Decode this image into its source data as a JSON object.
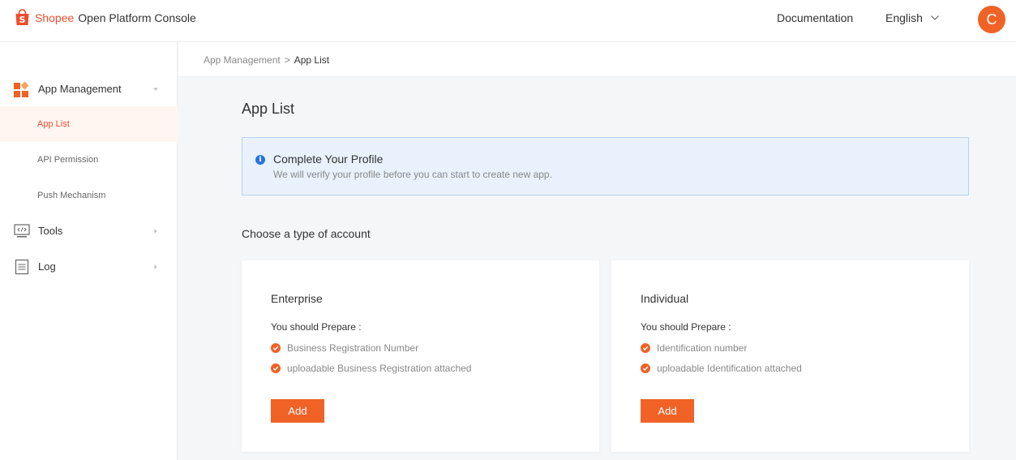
{
  "header": {
    "brand": "Shopee",
    "product": "Open Platform Console",
    "documentation": "Documentation",
    "language": "English",
    "avatar_initial": "C",
    "accent_color": "#ee4d2d"
  },
  "sidebar": {
    "groups": [
      {
        "label": "App Management",
        "icon": "app-grid-icon"
      },
      {
        "label": "Tools",
        "icon": "code-monitor-icon"
      },
      {
        "label": "Log",
        "icon": "document-icon"
      }
    ],
    "items": [
      {
        "label": "App List",
        "active": true
      },
      {
        "label": "API Permission",
        "active": false
      },
      {
        "label": "Push Mechanism",
        "active": false
      }
    ]
  },
  "breadcrumb": {
    "parent": "App Management",
    "separator": ">",
    "current": "App List"
  },
  "main": {
    "title": "App List",
    "notice": {
      "title": "Complete Your Profile",
      "message": "We will verify your profile before you can start to create new app.",
      "icon": "info-icon"
    },
    "choose_label": "Choose a type of account",
    "cards": [
      {
        "title": "Enterprise",
        "prepare": "You should Prepare :",
        "requirements": [
          "Business Registration Number",
          "uploadable Business Registration attached"
        ],
        "button": "Add"
      },
      {
        "title": "Individual",
        "prepare": "You should Prepare :",
        "requirements": [
          "Identification number",
          "uploadable Identification attached"
        ],
        "button": "Add"
      }
    ]
  }
}
